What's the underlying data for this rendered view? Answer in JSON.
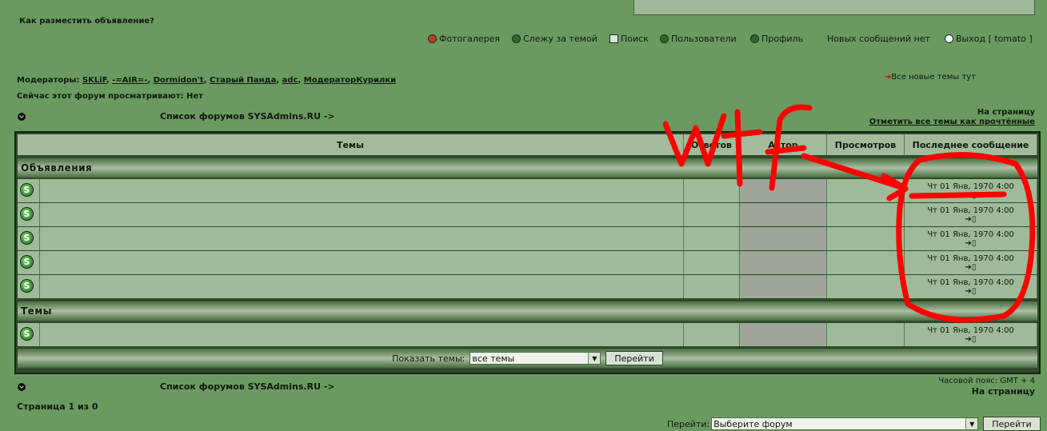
{
  "header": {
    "howto": "Как разместить объявление?",
    "nav": [
      "Фотогалерея",
      "Слежу за темой",
      "Поиск",
      "Пользователи",
      "Профиль"
    ],
    "new_messages": "Новых сообщений нет",
    "logout": "Выход [ tomato ]"
  },
  "info": {
    "moderators_label": "Модераторы:",
    "moderators": [
      "SKLiF",
      "-=AIR=-",
      "Dormidon't",
      "Старый Панда",
      "adc",
      "МодераторКурилки"
    ],
    "viewing": "Сейчас этот форум просматривают: Нет",
    "all_new": "Все новые темы тут"
  },
  "crumb": {
    "forum_list": "Список форумов SYSAdmins.RU ->",
    "to_page": "На страницу",
    "mark_read": "Отметить все темы как прочтённые"
  },
  "table": {
    "headers": [
      "Темы",
      "Ответов",
      "Автор",
      "Просмотров",
      "Последнее сообщение"
    ],
    "sections": [
      "Объявления",
      "Темы"
    ],
    "last_post": "Чт 01 Янв, 1970 4:00",
    "row_icon": "S"
  },
  "footer": {
    "show_label": "Показать темы:",
    "show_value": "все темы",
    "go": "Перейти",
    "timezone": "Часовой пояс: GMT + 4",
    "to_page": "На страницу",
    "page_info": "Страница 1 из 0",
    "jump_label": "Перейти:",
    "jump_value": "Выберите форум",
    "jump_go": "Перейти"
  },
  "annotation": {
    "text": "Wtf",
    "color": "#ff0000"
  }
}
